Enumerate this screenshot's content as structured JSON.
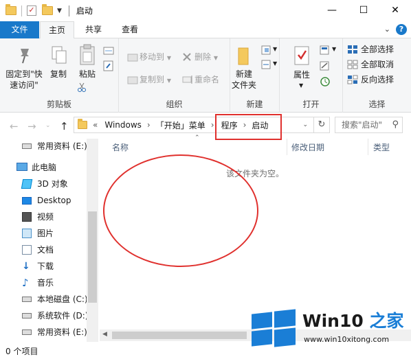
{
  "window": {
    "title": "启动",
    "buttons": {
      "minimize": "—",
      "maximize": "☐",
      "close": "✕"
    }
  },
  "ribbon_tabs": [
    {
      "label": "文件"
    },
    {
      "label": "主页"
    },
    {
      "label": "共享"
    },
    {
      "label": "查看"
    }
  ],
  "ribbon": {
    "clipboard": {
      "label": "剪贴板",
      "pin": "固定到\"快\n速访问\"",
      "copy": "复制",
      "paste": "粘贴"
    },
    "organize": {
      "label": "组织",
      "move_to": "移动到",
      "copy_to": "复制到",
      "delete": "删除",
      "rename": "重命名"
    },
    "new": {
      "label": "新建",
      "new_folder": "新建\n文件夹"
    },
    "open": {
      "label": "打开",
      "properties": "属性"
    },
    "select": {
      "label": "选择",
      "select_all": "全部选择",
      "select_none": "全部取消",
      "invert": "反向选择"
    }
  },
  "address": {
    "breadcrumb": [
      "Windows",
      "「开始」菜单",
      "程序",
      "启动"
    ],
    "overflow": "«",
    "search_placeholder": "搜索\"启动\""
  },
  "nav_pane": {
    "items": [
      {
        "label": "常用资料 (E:)",
        "icon": "drive-icon"
      },
      {
        "label": "此电脑",
        "icon": "computer-icon"
      },
      {
        "label": "3D 对象",
        "icon": "3d-objects-icon"
      },
      {
        "label": "Desktop",
        "icon": "desktop-icon"
      },
      {
        "label": "视频",
        "icon": "video-icon"
      },
      {
        "label": "图片",
        "icon": "pictures-icon"
      },
      {
        "label": "文档",
        "icon": "documents-icon"
      },
      {
        "label": "下载",
        "icon": "download-icon"
      },
      {
        "label": "音乐",
        "icon": "music-icon"
      },
      {
        "label": "本地磁盘 (C:)",
        "icon": "drive-icon"
      },
      {
        "label": "系统软件 (D:)",
        "icon": "drive-icon"
      },
      {
        "label": "常用资料 (E:)",
        "icon": "drive-icon"
      }
    ]
  },
  "content": {
    "columns": [
      "名称",
      "修改日期",
      "类型"
    ],
    "empty_message": "该文件夹为空。"
  },
  "status": {
    "item_count": "0 个项目"
  },
  "watermark": {
    "brand_prefix": "Win10 ",
    "brand_suffix": "之家",
    "url": "www.win10xitong.com"
  },
  "colors": {
    "accent": "#1979ca",
    "annotation": "#e0302d"
  }
}
